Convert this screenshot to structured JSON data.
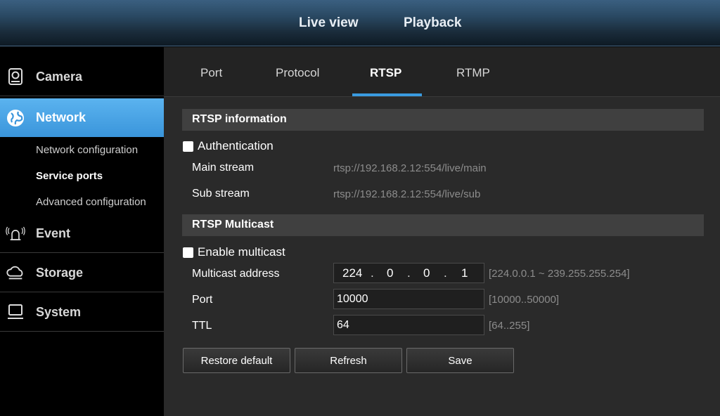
{
  "topnav": {
    "live_view": "Live view",
    "playback": "Playback"
  },
  "sidebar": {
    "camera": "Camera",
    "network": "Network",
    "network_sub": [
      "Network configuration",
      "Service ports",
      "Advanced configuration"
    ],
    "event": "Event",
    "storage": "Storage",
    "system": "System"
  },
  "tabs": [
    "Port",
    "Protocol",
    "RTSP",
    "RTMP"
  ],
  "active_tab": "RTSP",
  "rtsp_info": {
    "header": "RTSP information",
    "authentication_label": "Authentication",
    "authentication_checked": false,
    "main_stream_label": "Main stream",
    "main_stream_url": "rtsp://192.168.2.12:554/live/main",
    "sub_stream_label": "Sub stream",
    "sub_stream_url": "rtsp://192.168.2.12:554/live/sub"
  },
  "multicast": {
    "header": "RTSP Multicast",
    "enable_label": "Enable multicast",
    "enable_checked": false,
    "address_label": "Multicast address",
    "address_octets": [
      "224",
      "0",
      "0",
      "1"
    ],
    "address_hint": "[224.0.0.1 ~ 239.255.255.254]",
    "port_label": "Port",
    "port_value": "10000",
    "port_hint": "[10000..50000]",
    "ttl_label": "TTL",
    "ttl_value": "64",
    "ttl_hint": "[64..255]"
  },
  "buttons": {
    "restore": "Restore default",
    "refresh": "Refresh",
    "save": "Save"
  },
  "colors": {
    "accent": "#3a9be0",
    "active_sidebar": "#47a2e3"
  }
}
